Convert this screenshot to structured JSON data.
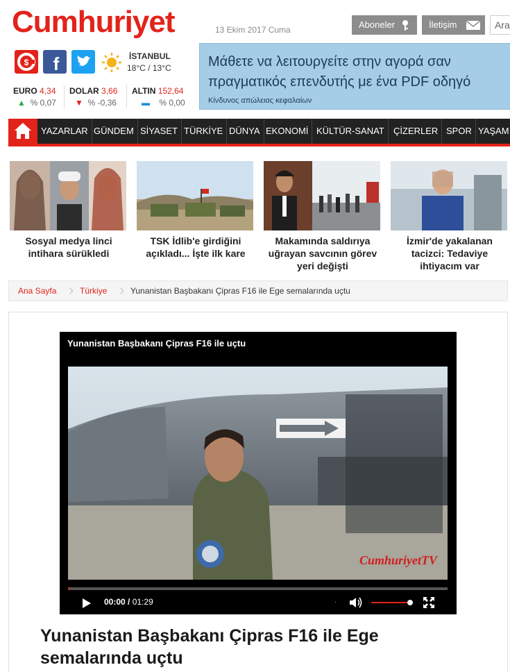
{
  "header": {
    "logo": "Cumhuriyet",
    "date": "13 Ekim 2017 Cuma",
    "subscribers_label": "Aboneler",
    "contact_label": "İletişim",
    "search_placeholder": "Ara"
  },
  "weather": {
    "city": "İSTANBUL",
    "temp": "18°C / 13°C"
  },
  "currencies": [
    {
      "name": "EURO",
      "value": "4,34",
      "change": "% 0,07",
      "dir": "up"
    },
    {
      "name": "DOLAR",
      "value": "3,66",
      "change": "% -0,36",
      "dir": "down"
    },
    {
      "name": "ALTIN",
      "value": "152,64",
      "change": "% 0,00",
      "dir": "flat"
    }
  ],
  "ad": {
    "line1": "Μάθετε να λειτουργείτε στην αγορά σαν πραγματικός επενδυτής με ένα PDF οδηγό",
    "line2": "Κίνδυνος απώλειας κεφαλαίων"
  },
  "nav": {
    "items": [
      "YAZARLAR",
      "GÜNDEM",
      "SİYASET",
      "TÜRKİYE",
      "DÜNYA",
      "EKONOMİ",
      "KÜLTÜR-SANAT",
      "ÇİZERLER",
      "SPOR",
      "YAŞAM"
    ]
  },
  "news": [
    {
      "caption": "Sosyal medya linci intihara sürükledi"
    },
    {
      "caption": "TSK İdlib'e girdiğini açıkladı... İşte ilk kare"
    },
    {
      "caption": "Makamında saldırıya uğrayan savcının görev yeri değişti"
    },
    {
      "caption": "İzmir'de yakalanan tacizci: Tedaviye ihtiyacım var"
    }
  ],
  "breadcrumb": [
    "Ana Sayfa",
    "Türkiye",
    "Yunanistan Başbakanı Çipras F16 ile Ege semalarında uçtu"
  ],
  "video": {
    "title": "Yunanistan Başbakanı Çipras F16 ile uçtu",
    "current_time": "00:00",
    "duration": "01:29",
    "watermark": "CumhuriyetTV",
    "progress_fraction": 0,
    "volume_fraction": 1
  },
  "article": {
    "headline": "Yunanistan Başbakanı Çipras F16 ile Ege semalarında uçtu"
  },
  "colors": {
    "brand_red": "#e2231a",
    "nav_bg": "#222222",
    "ad_bg": "#a5cde7"
  }
}
